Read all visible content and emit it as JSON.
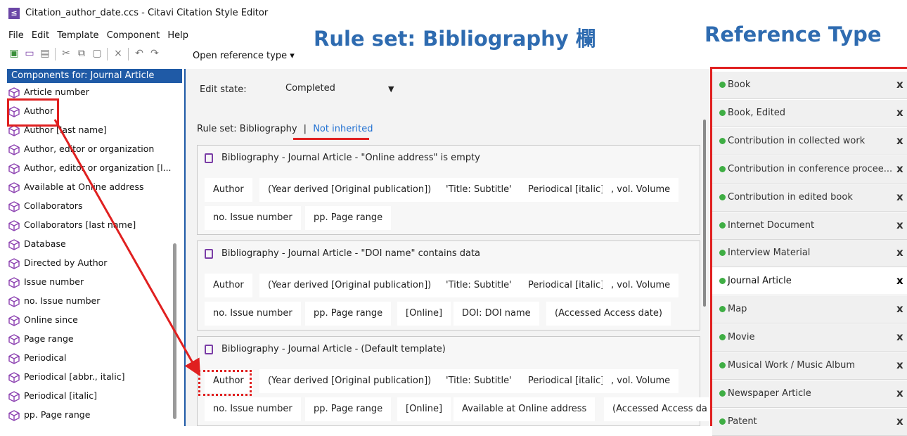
{
  "window": {
    "title": "Citation_author_date.ccs - Citavi Citation Style Editor",
    "app_icon": "citavi-app-icon"
  },
  "menu": [
    "File",
    "Edit",
    "Template",
    "Component",
    "Help"
  ],
  "toolbar": {
    "open_reference_type": "Open reference type ▾"
  },
  "annotations": {
    "rule_set": "Rule set: Bibliography 欄",
    "reference_type": "Reference Type"
  },
  "components": {
    "header": "Components for: Journal Article",
    "items": [
      "Article number",
      "Author",
      "Author [last name]",
      "Author, editor or organization",
      "Author, editor or organization [l...",
      "Available at Online address",
      "Collaborators",
      "Collaborators [last name]",
      "Database",
      "Directed by Author",
      "Issue number",
      "no. Issue number",
      "Online since",
      "Page range",
      "Periodical",
      "Periodical [abbr., italic]",
      "Periodical [italic]",
      "pp. Page range"
    ]
  },
  "editor": {
    "edit_state_label": "Edit state:",
    "edit_state_value": "Completed",
    "ruleset_label": "Rule set: Bibliography",
    "separator": "|",
    "not_inherited": "Not inherited",
    "rules": [
      {
        "title": "Bibliography - Journal Article - \"Online address\" is empty",
        "row1": [
          "Author",
          "(Year derived [Original publication])",
          "'Title: Subtitle'",
          "Periodical [italic]",
          ", vol. Volume"
        ],
        "row2": [
          "no. Issue number",
          "pp. Page range"
        ]
      },
      {
        "title": "Bibliography - Journal Article - \"DOI name\" contains data",
        "row1": [
          "Author",
          "(Year derived [Original publication])",
          "'Title: Subtitle'",
          "Periodical [italic]",
          ", vol. Volume"
        ],
        "row2": [
          "no. Issue number",
          "pp. Page range",
          "[Online]",
          "DOI: DOI name",
          "(Accessed Access date)"
        ]
      },
      {
        "title": "Bibliography - Journal Article - (Default template)",
        "row1": [
          "Author",
          "(Year derived [Original publication])",
          "'Title: Subtitle'",
          "Periodical [italic]",
          ", vol. Volume"
        ],
        "row2": [
          "no. Issue number",
          "pp. Page range",
          "[Online]",
          "Available at Online address",
          "(Accessed Access da"
        ]
      }
    ]
  },
  "reference_types": {
    "items": [
      "Book",
      "Book, Edited",
      "Contribution in collected work",
      "Contribution in conference procee...",
      "Contribution in edited book",
      "Internet Document",
      "Interview Material",
      "Journal Article",
      "Map",
      "Movie",
      "Musical Work / Music Album",
      "Newspaper Article",
      "Patent"
    ],
    "selected": "Journal Article",
    "remove_glyph": "x",
    "status_color": "#3fae44"
  },
  "colors": {
    "accent": "#1f5aa6",
    "annotation": "#2e6bb0",
    "highlight": "#e02020",
    "link": "#1f6fd1"
  }
}
